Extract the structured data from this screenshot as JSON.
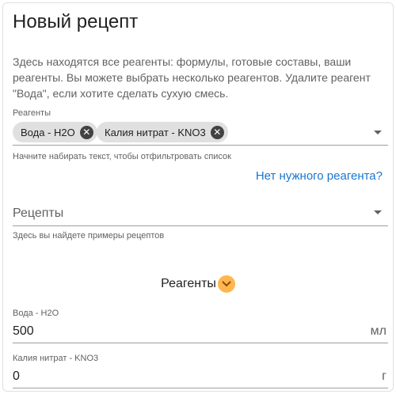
{
  "form": {
    "title": "Новый рецепт",
    "description": "Здесь находятся все реагенты: формулы, готовые составы, ваши реагенты. Вы можете выбрать несколько реагентов. Удалите реагент \"Вода\", если хотите сделать сухую смесь."
  },
  "reagents_field": {
    "label": "Реагенты",
    "chips": [
      {
        "label": "Вода - H2O"
      },
      {
        "label": "Калия нитрат - KNO3"
      }
    ],
    "hint": "Начните набирать текст, чтобы отфильтровать список",
    "missing_link": "Нет нужного реагента?"
  },
  "recipes_field": {
    "placeholder": "Рецепты",
    "hint": "Здесь вы найдете примеры рецептов"
  },
  "reagents_section": {
    "title": "Реагенты",
    "toggle_icon": "chevron-down-icon",
    "toggle_color": "#ffb74d"
  },
  "amounts": [
    {
      "label": "Вода - H2O",
      "value": "500",
      "unit": "мл"
    },
    {
      "label": "Калия нитрат - KNO3",
      "value": "0",
      "unit": "г"
    }
  ],
  "colors": {
    "link": "#1976d2",
    "chip_bg": "#e0e0e0"
  }
}
